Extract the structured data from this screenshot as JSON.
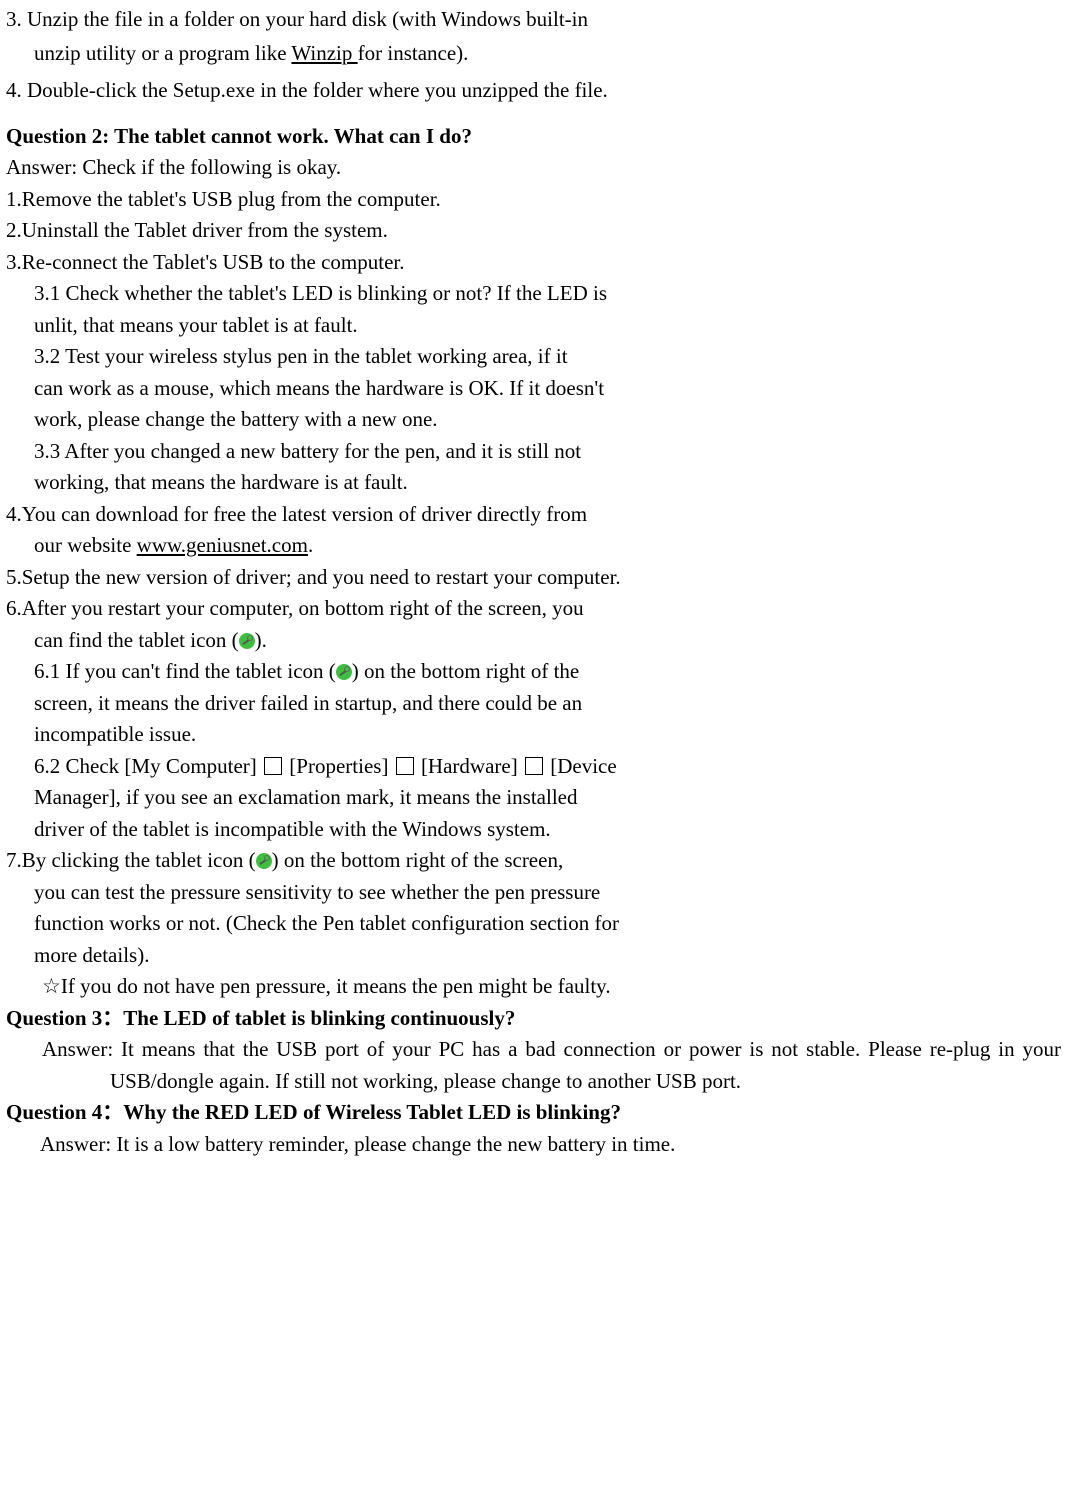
{
  "step3_idx": "3.",
  "step3_line1": "Unzip the file in a folder on your hard disk (with Windows built-in",
  "step3_line2": "unzip utility or a program like ",
  "step3_link": "Winzip ",
  "step3_line2b": "for instance).",
  "step4_idx": "4.",
  "step4_text": "Double-click the Setup.exe in the folder where you unzipped the file.",
  "q2_title": "Question 2: The tablet cannot work. What can I do?",
  "q2_ans_label": "Answer: Check if the following is okay.",
  "q2_s1": "1.Remove the tablet's USB plug from the computer.",
  "q2_s2": "2.Uninstall the Tablet driver from the system.",
  "q2_s3": "3.Re-connect the Tablet's USB to the computer.",
  "q2_s3_1a": "3.1 Check whether the tablet's LED is blinking or not? If the LED is",
  "q2_s3_1b": "unlit, that means your tablet is at fault.",
  "q2_s3_2a": "3.2 Test your wireless stylus pen in the tablet working area, if it",
  "q2_s3_2b": "can work as a mouse, which means the hardware is OK. If it doesn't",
  "q2_s3_2c": "work, please change the battery with a new one.",
  "q2_s3_3a": "3.3 After you changed a new battery for the pen, and it is still not",
  "q2_s3_3b": "working, that means the hardware is at fault.",
  "q2_s4a": "4.You can download for free the latest version of driver directly from",
  "q2_s4b_pre": "our website ",
  "q2_s4b_link": "www.geniusnet.com",
  "q2_s4b_post": ".",
  "q2_s5": "5.Setup the new version of driver; and you need to restart your computer.",
  "q2_s6a": "6.After you restart your computer, on bottom right of the screen, you",
  "q2_s6b_pre": "can find the tablet icon (",
  "q2_s6b_post": ").",
  "q2_s6_1a_pre": "6.1 If you can't find the tablet icon (",
  "q2_s6_1a_post": ") on the bottom right of the",
  "q2_s6_1b": "screen, it means the driver failed in startup, and there could be an",
  "q2_s6_1c": "incompatible issue.",
  "q2_s6_2_pre": "6.2 Check  [My Computer]  ",
  "q2_s6_2_prop": "  [Properties]  ",
  "q2_s6_2_hw": "  [Hardware]  ",
  "q2_s6_2_dm": "  [Device",
  "q2_s6_2b": "Manager], if you see an exclamation mark, it means the installed",
  "q2_s6_2c": "driver of the tablet is incompatible with the Windows system.",
  "q2_s7a_pre": "7.By clicking the tablet icon (",
  "q2_s7a_post": ") on the bottom right of the screen,",
  "q2_s7b": "you can test the pressure sensitivity to see whether the pen pressure",
  "q2_s7c": "function works or not. (Check the Pen tablet configuration section for",
  "q2_s7d": "more details).",
  "q2_star": "☆If you do not have pen pressure, it means the pen might be faulty.",
  "q3_title": "Question 3：The LED of tablet is blinking continuously?",
  "q3_ans": "Answer: It means that the USB port of your PC has a bad connection or power is not stable. Please re-plug in your USB/dongle again. If still not working, please change to another USB port.",
  "q4_title": "Question 4：Why the RED LED of Wireless Tablet LED is blinking?",
  "q4_ans": "Answer: It is a low battery reminder, please change the new battery in time."
}
